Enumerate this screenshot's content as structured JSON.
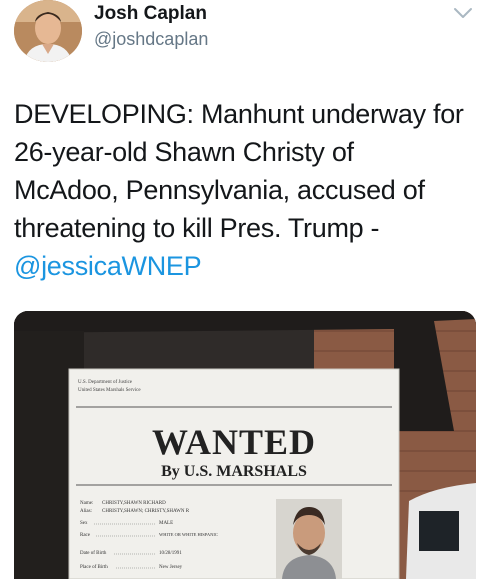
{
  "author": {
    "display_name": "Josh Caplan",
    "handle": "@joshdcaplan"
  },
  "header": {
    "menu_icon": "chevron-down-icon"
  },
  "tweet": {
    "text_lines": [
      "DEVELOPING: Manhunt underway for",
      "26-year-old Shawn Christy of",
      "McAdoo, Pennsylvania, accused of",
      "threatening to kill Pres. Trump -"
    ],
    "mention": "@jessicaWNEP"
  },
  "media": {
    "poster": {
      "agency_line1": "U.S. Department of Justice",
      "agency_line2": "United States Marshals Service",
      "headline": "WANTED",
      "subheadline": "By U.S. MARSHALS",
      "fields": [
        {
          "label": "Name:",
          "value": "CHRISTY,SHAWN RICHARD"
        },
        {
          "label": "Alias:",
          "value": "CHRISTY,SHAWN; CHRISTY,SHAWN R"
        },
        {
          "label": "Sex",
          "value": "MALE"
        },
        {
          "label": "Race",
          "value": "WHITE OR WHITE HISPANIC"
        },
        {
          "label": "Date of Birth",
          "value": "10/28/1991"
        },
        {
          "label": "Place of Birth",
          "value": "New Jersey"
        }
      ]
    }
  },
  "colors": {
    "text": "#14171a",
    "secondary": "#657786",
    "link": "#1b95e0"
  }
}
